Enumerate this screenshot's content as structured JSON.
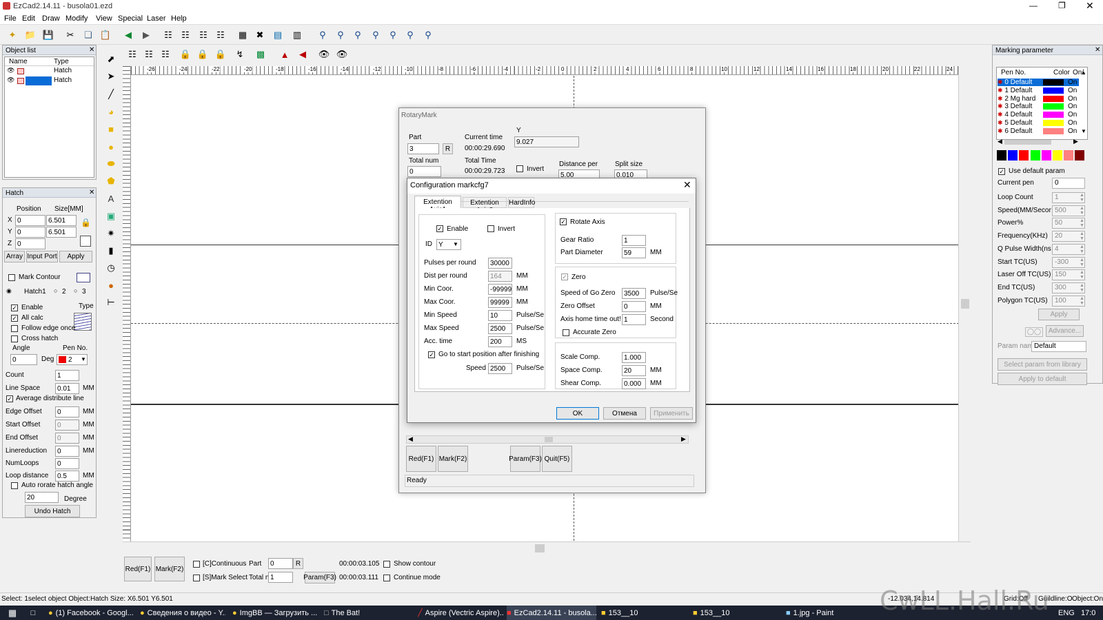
{
  "window": {
    "title": "EzCad2.14.11 - busola01.ezd"
  },
  "menu": [
    "File",
    "Edit",
    "Draw",
    "Modify",
    "View",
    "Special",
    "Laser",
    "Help"
  ],
  "object_list": {
    "title": "Object list",
    "col_name": "Name",
    "col_type": "Type",
    "rows": [
      {
        "type": "Hatch"
      },
      {
        "type": "Hatch"
      }
    ]
  },
  "hatch_panel": {
    "title": "Hatch",
    "position": "Position",
    "size": "Size[MM]",
    "x": "0",
    "y": "0",
    "z": "0",
    "sx": "6.501",
    "sy": "6.501",
    "array": "Array",
    "input_port": "Input Port",
    "apply": "Apply",
    "mark_contour": "Mark Contour",
    "hatch1": "Hatch1",
    "r2": "2",
    "r3": "3",
    "enable": "Enable",
    "type": "Type",
    "all_calc": "All calc",
    "follow_edge": "Follow edge once",
    "cross_hatch": "Cross hatch",
    "angle": "Angle",
    "pen_no": "Pen No.",
    "angle_val": "0",
    "deg": "Deg",
    "pen_val": "2",
    "count": "Count",
    "count_val": "1",
    "line_space": "Line Space",
    "line_space_val": "0.01",
    "mm": "MM",
    "avg_dist": "Average distribute line",
    "edge_offset": "Edge Offset",
    "edge_offset_val": "0",
    "start_offset": "Start Offset",
    "start_offset_val": "0",
    "end_offset": "End Offset",
    "end_offset_val": "0",
    "linereduction": "Linereduction",
    "linereduction_val": "0",
    "numloops": "NumLoops",
    "numloops_val": "0",
    "loop_distance": "Loop distance",
    "loop_distance_val": "0.5",
    "auto_rotate": "Auto rorate hatch angle",
    "auto_rotate_val": "20",
    "degree": "Degree",
    "undo": "Undo Hatch"
  },
  "ruler": {
    "top_ticks": [
      "-26",
      "-24",
      "-22",
      "-20",
      "-18",
      "-16",
      "-14",
      "-12",
      "-10",
      "-8",
      "-6",
      "-4",
      "-2",
      "0",
      "2",
      "4",
      "6",
      "8",
      "10",
      "12",
      "14",
      "16",
      "18",
      "20",
      "22",
      "24"
    ]
  },
  "bottom_bar": {
    "red": "Red(F1)",
    "mark": "Mark(F2)",
    "continuous": "[C]Continuous",
    "mark_select": "[S]Mark Select",
    "part": "Part",
    "part_val": "0",
    "r": "R",
    "total": "Total n",
    "total_val": "1",
    "param": "Param(F3)",
    "time1": "00:00:03.105",
    "time2": "00:00:03.111",
    "show_contour": "Show contour",
    "continue_mode": "Continue mode"
  },
  "status": {
    "text": "Select: 1select object Object:Hatch Size: X6.501 Y6.501",
    "coords": "-12.034,14.814",
    "grid": "Grid:Off",
    "guild": "Guildline:O",
    "object": "Object:On"
  },
  "marking_param": {
    "title": "Marking parameter",
    "col_pen": "Pen No.",
    "col_color": "Color",
    "col_on": "On/",
    "pens": [
      {
        "name": "0 Default",
        "color": "#000000",
        "on": "On"
      },
      {
        "name": "1 Default",
        "color": "#0000ff",
        "on": "On"
      },
      {
        "name": "2 Mg hard",
        "color": "#ff0000",
        "on": "On"
      },
      {
        "name": "3 Default",
        "color": "#00ff00",
        "on": "On"
      },
      {
        "name": "4 Default",
        "color": "#ff00ff",
        "on": "On"
      },
      {
        "name": "5 Default",
        "color": "#ffff00",
        "on": "On"
      },
      {
        "name": "6 Default",
        "color": "#ff8080",
        "on": "On"
      }
    ],
    "palette": [
      "#000000",
      "#0000ff",
      "#ff0000",
      "#00ff00",
      "#ff00ff",
      "#ffff00",
      "#ff8080",
      "#800000"
    ],
    "use_default": "Use default param",
    "current_pen": "Current pen",
    "current_pen_val": "0",
    "params": [
      {
        "label": "Loop Count",
        "val": "1"
      },
      {
        "label": "Speed(MM/Second)",
        "val": "500"
      },
      {
        "label": "Power%",
        "val": "50"
      },
      {
        "label": "Frequency(KHz)",
        "val": "20"
      },
      {
        "label": "Q Pulse Width(ns)",
        "val": "4"
      },
      {
        "label": "Start TC(US)",
        "val": "-300"
      },
      {
        "label": "Laser Off TC(US)",
        "val": "150"
      },
      {
        "label": "End TC(US)",
        "val": "300"
      },
      {
        "label": "Polygon TC(US)",
        "val": "100"
      }
    ],
    "apply": "Apply",
    "advance": "Advance...",
    "param_name": "Param name",
    "param_name_val": "Default",
    "select_lib": "Select param from library",
    "apply_default": "Apply to default"
  },
  "rotary": {
    "title": "RotaryMark",
    "part": "Part",
    "part_val": "3",
    "r": "R",
    "current_time": "Current time",
    "current_time_val": "00:00:29.690",
    "y_label": "Y",
    "y_val": "9.027",
    "total_num": "Total num",
    "total_num_val": "0",
    "total_time": "Total Time",
    "total_time_val": "00:00:29.723",
    "invert": "Invert",
    "distance_per": "Distance per",
    "distance_val": "5.00",
    "split_size": "Split size",
    "split_val": "0.010",
    "red": "Red(F1)",
    "mark": "Mark(F2)",
    "param": "Param(F3)",
    "quit": "Quit(F5)",
    "status": "Ready"
  },
  "config": {
    "title": "Configuration markcfg7",
    "tabs": [
      "Extention Axis1",
      "Extention Axis2",
      "HardInfo"
    ],
    "enable": "Enable",
    "invert": "Invert",
    "id": "ID",
    "id_val": "Y",
    "pulses": "Pulses per round",
    "pulses_val": "30000",
    "dist": "Dist per round",
    "dist_val": "164",
    "min_coor": "Min Coor.",
    "min_coor_val": "-99999",
    "max_coor": "Max Coor.",
    "max_coor_val": "99999",
    "min_speed": "Min Speed",
    "min_speed_val": "10",
    "max_speed": "Max Speed",
    "max_speed_val": "2500",
    "acc": "Acc. time",
    "acc_val": "200",
    "go_start": "Go to start position after finishing",
    "speed": "Speed",
    "speed_val": "2500",
    "mm": "MM",
    "pulse_se": "Pulse/Se",
    "ms": "MS",
    "rotate_axis": "Rotate Axis",
    "gear": "Gear Ratio",
    "gear_val": "1",
    "part_dia": "Part Diameter",
    "part_dia_val": "59",
    "zero": "Zero",
    "go_zero": "Speed of Go Zero",
    "go_zero_val": "3500",
    "zero_offset": "Zero Offset",
    "zero_offset_val": "0",
    "home_timeout": "Axis home time out!",
    "home_timeout_val": "1",
    "second": "Second",
    "accurate_zero": "Accurate Zero",
    "scale": "Scale Comp.",
    "scale_val": "1.000",
    "space": "Space Comp.",
    "space_val": "20",
    "shear": "Shear Comp.",
    "shear_val": "0.000",
    "ok": "OK",
    "cancel": "Отмена",
    "apply": "Применить"
  },
  "taskbar": {
    "items": [
      "(1) Facebook - Googl...",
      "Сведения о видео - Y...",
      "ImgBB — Загрузить ...",
      "The Bat!",
      "Aspire (Vectric Aspire)...",
      "EzCad2.14.11 - busola...",
      "153__10",
      "153__10",
      "1.jpg - Paint"
    ],
    "lang": "ENG",
    "time": "17:0"
  },
  "watermark": "CwLL.Hall.Ru"
}
